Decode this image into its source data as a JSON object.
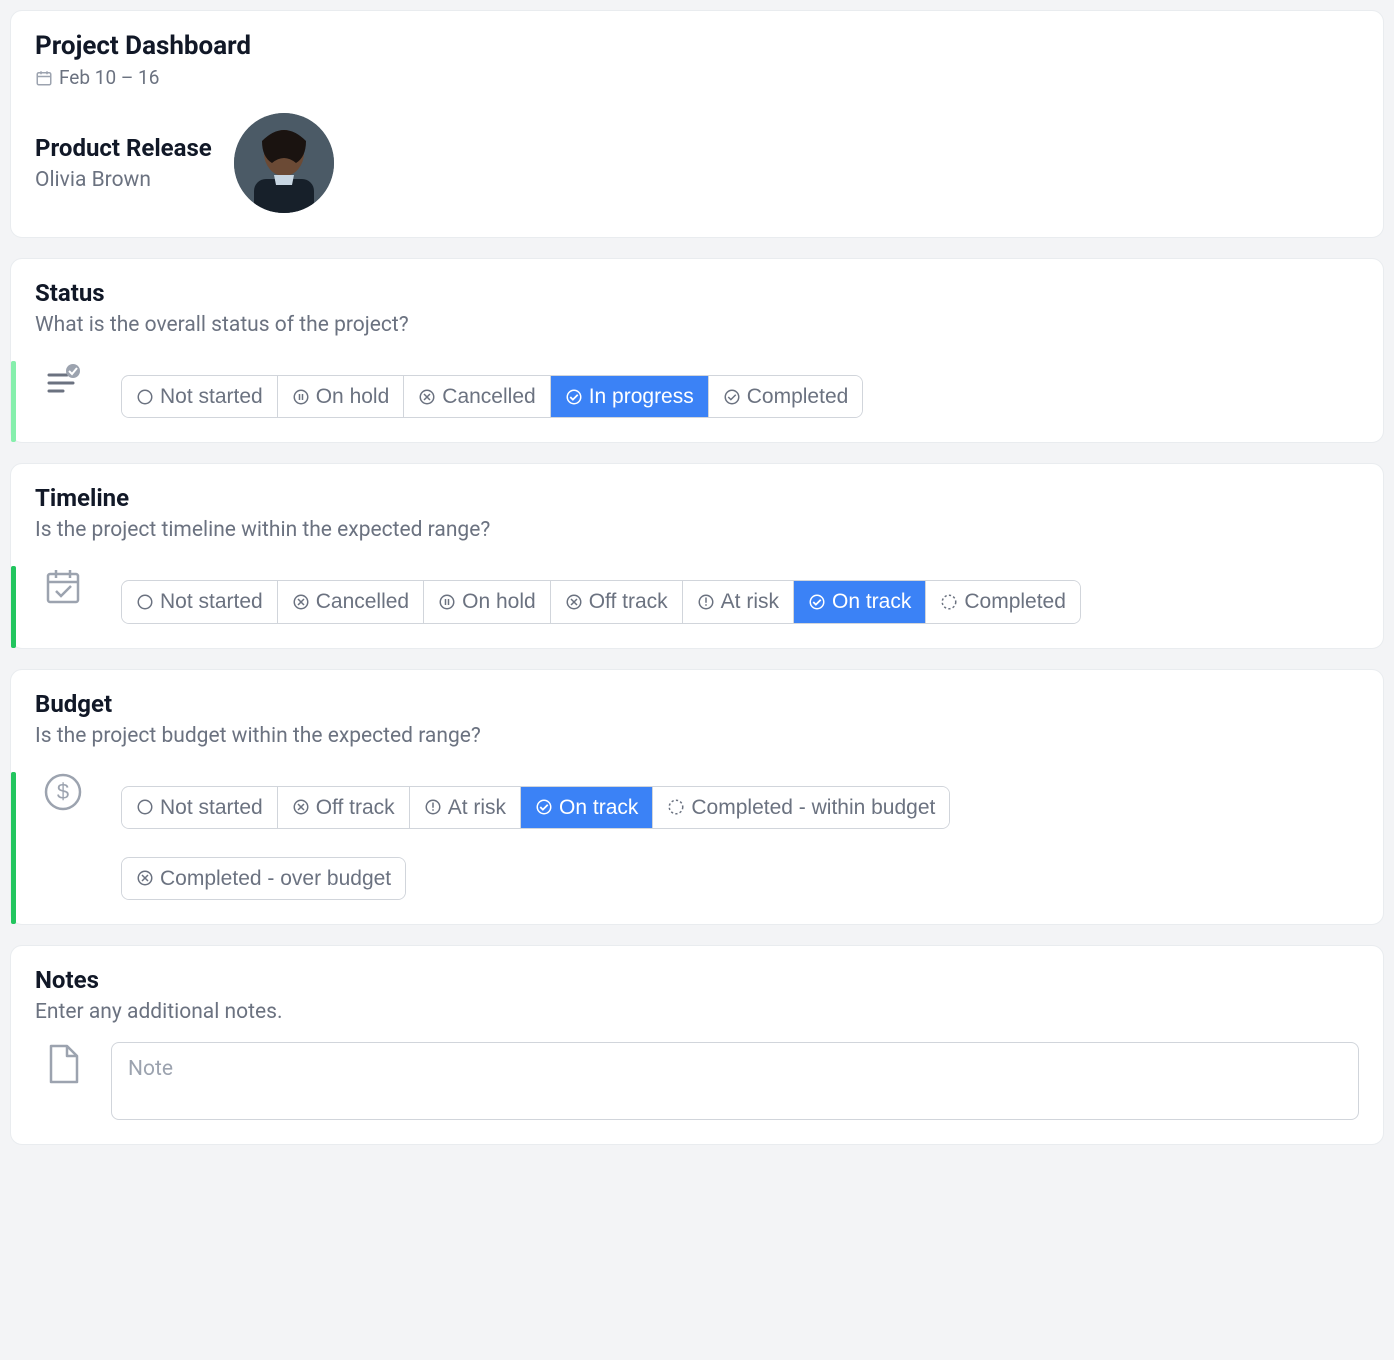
{
  "header": {
    "title": "Project Dashboard",
    "date_range": "Feb 10 – 16",
    "project_name": "Product Release",
    "person_name": "Olivia Brown"
  },
  "status": {
    "title": "Status",
    "desc": "What is the overall status of the project?",
    "options": [
      {
        "label": "Not started",
        "icon": "circle"
      },
      {
        "label": "On hold",
        "icon": "pause"
      },
      {
        "label": "Cancelled",
        "icon": "x-circle"
      },
      {
        "label": "In progress",
        "icon": "check-circle-filled",
        "active": true
      },
      {
        "label": "Completed",
        "icon": "check-circle"
      }
    ]
  },
  "timeline": {
    "title": "Timeline",
    "desc": "Is the project timeline within the expected range?",
    "options": [
      {
        "label": "Not started",
        "icon": "circle"
      },
      {
        "label": "Cancelled",
        "icon": "x-circle"
      },
      {
        "label": "On hold",
        "icon": "pause"
      },
      {
        "label": "Off track",
        "icon": "x-circle"
      },
      {
        "label": "At risk",
        "icon": "alert"
      },
      {
        "label": "On track",
        "icon": "check-circle-filled",
        "active": true
      },
      {
        "label": "Completed",
        "icon": "gear"
      }
    ]
  },
  "budget": {
    "title": "Budget",
    "desc": "Is the project budget within the expected range?",
    "options": [
      {
        "label": "Not started",
        "icon": "circle"
      },
      {
        "label": "Off track",
        "icon": "x-circle"
      },
      {
        "label": "At risk",
        "icon": "alert"
      },
      {
        "label": "On track",
        "icon": "check-circle-filled",
        "active": true
      },
      {
        "label": "Completed - within budget",
        "icon": "gear"
      }
    ],
    "options_row2": [
      {
        "label": "Completed - over budget",
        "icon": "x-circle"
      }
    ]
  },
  "notes": {
    "title": "Notes",
    "desc": "Enter any additional notes.",
    "placeholder": "Note"
  },
  "colors": {
    "accent": "#3b82f6",
    "green_light": "#86efac",
    "green_dark": "#22c55e"
  }
}
